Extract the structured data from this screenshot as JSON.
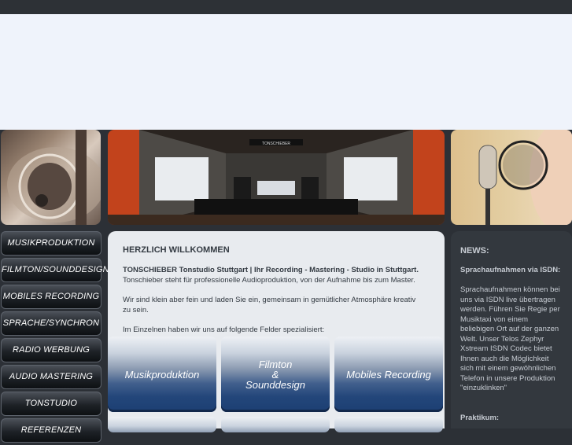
{
  "header": {},
  "photos": {
    "left_alt": "microphone-closeup",
    "middle_alt": "studio-control-room",
    "right_alt": "singer-at-microphone",
    "studio_sign": "TONSCHIEBER"
  },
  "nav": {
    "items": [
      {
        "label": "MUSIKPRODUKTION"
      },
      {
        "label": "FILMTON/SOUNDDESIGN"
      },
      {
        "label": "MOBILES RECORDING"
      },
      {
        "label": "SPRACHE/SYNCHRON"
      },
      {
        "label": "RADIO WERBUNG"
      },
      {
        "label": "AUDIO MASTERING"
      },
      {
        "label": "TONSTUDIO"
      },
      {
        "label": "REFERENZEN"
      }
    ]
  },
  "content": {
    "heading": "HERZLICH WILLKOMMEN",
    "intro_bold": "TONSCHIEBER Tonstudio Stuttgart | Ihr Recording - Mastering - Studio in Stuttgart.",
    "intro_line": "Tonschieber steht für professionelle Audioproduktion, von der Aufnahme bis zum Master.",
    "para2_line1": "Wir sind klein aber fein und laden Sie ein, gemeinsam in gemütlicher Atmosphäre kreativ",
    "para2_line2": "zu sein.",
    "para3": "Im Einzelnen haben wir uns auf folgende Felder spezialisiert:"
  },
  "tiles": [
    {
      "line1": "Musikproduktion",
      "line2": "",
      "line3": ""
    },
    {
      "line1": "Filmton",
      "line2": "&",
      "line3": "Sounddesign"
    },
    {
      "line1": "Mobiles Recording",
      "line2": "",
      "line3": ""
    }
  ],
  "news": {
    "title": "NEWS:",
    "item_heading": "Sprachaufnahmen via ISDN:",
    "item_body": "Sprachaufnahmen können bei uns via ISDN live übertragen werden. Führen Sie Regie per Musiktaxi von einem beliebigen Ort auf der ganzen Welt. Unser Telos Zephyr Xstream ISDN Codec bietet Ihnen auch die Möglichkeit sich mit einem gewöhnlichen Telefon in unsere Produktion \"einzuklinken\"",
    "item2_heading": "Praktikum:"
  },
  "colors": {
    "background": "#2c3036",
    "header": "#eff3fb",
    "content_panel": "#e8ebef",
    "news_panel": "#33383e",
    "tile_blue": "#23467a"
  }
}
